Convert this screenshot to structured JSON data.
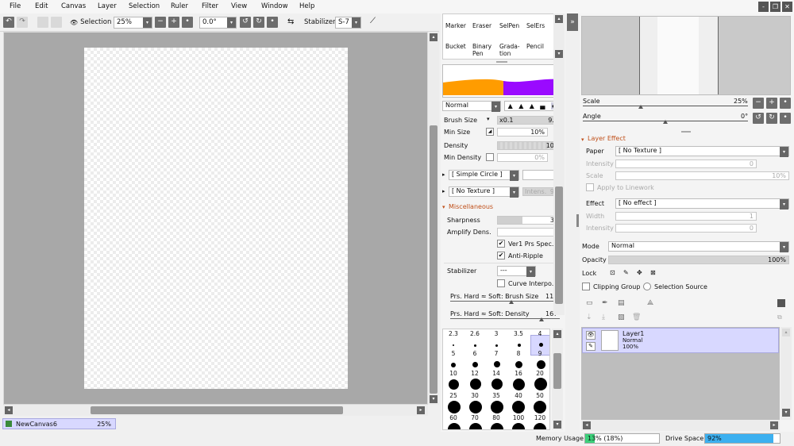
{
  "menu": [
    "File",
    "Edit",
    "Canvas",
    "Layer",
    "Selection",
    "Ruler",
    "Filter",
    "View",
    "Window",
    "Help"
  ],
  "window_buttons": [
    "-",
    "❐",
    "✕"
  ],
  "toolbar": {
    "selection_label": "Selection",
    "zoom": "25%",
    "angle": "0.0°",
    "stabilizer_label": "Stabilizer",
    "stabilizer_value": "S-7"
  },
  "canvas_tab": {
    "name": "NewCanvas6",
    "zoom": "25%"
  },
  "tools": [
    {
      "label": "Marker"
    },
    {
      "label": "Eraser"
    },
    {
      "label": "SelPen"
    },
    {
      "label": "SelErs"
    },
    {
      "label": "Bucket"
    },
    {
      "label": "Binary\nPen"
    },
    {
      "label": "Grada-\ntion"
    },
    {
      "label": "Pencil"
    }
  ],
  "colors": {
    "accent_orange": "#ff9c00",
    "accent_purple": "#9a0aff",
    "selection_blue": "#d8d8ff",
    "section_orange": "#c0501a"
  },
  "brush": {
    "blend_mode": "Normal",
    "brush_size_label": "Brush Size",
    "brush_size_mult": "x0.1",
    "brush_size_value": "9.0",
    "min_size_label": "Min Size",
    "min_size_value": "10%",
    "density_label": "Density",
    "density_value": "100",
    "min_density_label": "Min Density",
    "min_density_value": "0%",
    "shape": "[ Simple Circle ]",
    "texture": "[ No Texture ]",
    "texture_intensity": "Intens.",
    "texture_intensity_value": "95",
    "misc_label": "Miscellaneous",
    "sharpness_label": "Sharpness",
    "sharpness_value": "39",
    "amplify_label": "Amplify Dens.",
    "amplify_value": "0",
    "ver1_label": "Ver1 Prs Spec.",
    "antiripple_label": "Anti-Ripple",
    "stabilizer_label": "Stabilizer",
    "stabilizer_value": "---",
    "curve_label": "Curve Interpo.",
    "prs_size_label": "Prs. Hard ≈ Soft: Brush Size",
    "prs_size_value": "112",
    "prs_density_label": "Prs. Hard ≈ Soft: Density",
    "prs_density_value": "167"
  },
  "brush_sizes": [
    {
      "row": [
        "2.3",
        "2.6",
        "3",
        "3.5",
        "4"
      ]
    },
    {
      "row": [
        "5",
        "6",
        "7",
        "8",
        "9"
      ]
    },
    {
      "row": [
        "10",
        "12",
        "14",
        "16",
        "20"
      ]
    },
    {
      "row": [
        "25",
        "30",
        "35",
        "40",
        "50"
      ]
    },
    {
      "row": [
        "60",
        "70",
        "80",
        "100",
        "120"
      ]
    }
  ],
  "navigator": {
    "scale_label": "Scale",
    "scale_value": "25%",
    "angle_label": "Angle",
    "angle_value": "0°"
  },
  "layer_effect": {
    "section_label": "Layer Effect",
    "paper_label": "Paper",
    "paper_value": "[ No Texture ]",
    "intensity_label": "Intensity",
    "intensity_value": "0",
    "scale_label": "Scale",
    "scale_value": "10%",
    "apply_linework": "Apply to Linework",
    "effect_label": "Effect",
    "effect_value": "[ No effect ]",
    "width_label": "Width",
    "width_value": "1",
    "intensity2_label": "Intensity",
    "intensity2_value": "0"
  },
  "layer_props": {
    "mode_label": "Mode",
    "mode_value": "Normal",
    "opacity_label": "Opacity",
    "opacity_value": "100%",
    "lock_label": "Lock",
    "clipping_label": "Clipping Group",
    "selection_source_label": "Selection Source"
  },
  "layers": [
    {
      "name": "Layer1",
      "mode": "Normal",
      "opacity": "100%"
    }
  ],
  "status": {
    "memory_label": "Memory Usage",
    "memory_value": "13% (18%)",
    "memory_fill": 0.13,
    "drive_label": "Drive Space",
    "drive_value": "92%",
    "drive_fill": 0.92
  }
}
